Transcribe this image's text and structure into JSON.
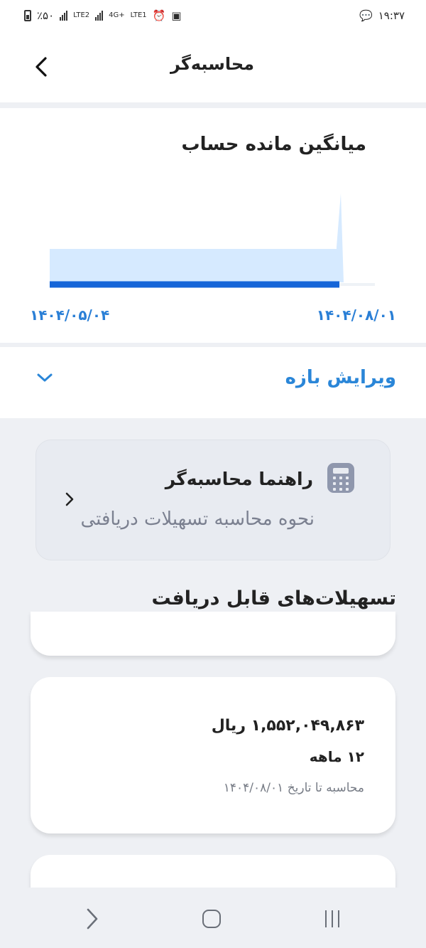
{
  "status_bar": {
    "time": "۱۹:۳۷",
    "battery": "٪۵۰",
    "network1": "LTE2",
    "network2": "LTE1",
    "network_type": "4G+"
  },
  "header": {
    "title": "محاسبه‌گر"
  },
  "chart": {
    "title": "میانگین مانده حساب"
  },
  "chart_data": {
    "type": "area",
    "x": [
      "۱۴۰۴/۰۵/۰۴",
      "۱۴۰۴/۰۸/۰۱"
    ],
    "title": "میانگین مانده حساب",
    "grid": false
  },
  "range": {
    "label": "ویرایش بازه"
  },
  "guide": {
    "title": "راهنما محاسبه‌گر",
    "subtitle": "نحوه محاسبه تسهیلات دریافتی"
  },
  "section": {
    "title": "تسهیلات‌های قابل دریافت"
  },
  "facilities": [
    {
      "amount": "۱,۵۵۲,۰۴۹,۸۶۳ ریال",
      "term": "۱۲ ماهه",
      "calc_date": "محاسبه تا تاریخ ۱۴۰۴/۰۸/۰۱"
    }
  ],
  "colors": {
    "accent": "#2a86d8",
    "chart_fill": "#d6eaff",
    "chart_line": "#1565d8",
    "background": "#eef0f4"
  }
}
